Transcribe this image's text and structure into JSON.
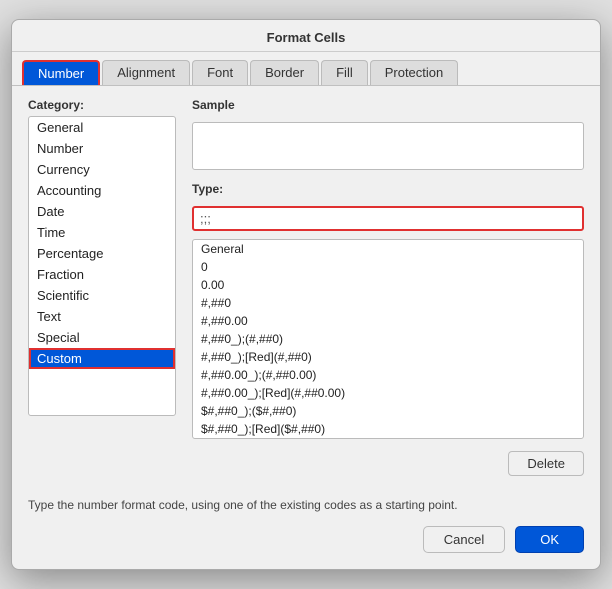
{
  "dialog": {
    "title": "Format Cells"
  },
  "tabs": [
    {
      "id": "number",
      "label": "Number",
      "active": true
    },
    {
      "id": "alignment",
      "label": "Alignment",
      "active": false
    },
    {
      "id": "font",
      "label": "Font",
      "active": false
    },
    {
      "id": "border",
      "label": "Border",
      "active": false
    },
    {
      "id": "fill",
      "label": "Fill",
      "active": false
    },
    {
      "id": "protection",
      "label": "Protection",
      "active": false
    }
  ],
  "left": {
    "category_label": "Category:",
    "categories": [
      {
        "id": "general",
        "label": "General",
        "selected": false
      },
      {
        "id": "number",
        "label": "Number",
        "selected": false
      },
      {
        "id": "currency",
        "label": "Currency",
        "selected": false
      },
      {
        "id": "accounting",
        "label": "Accounting",
        "selected": false
      },
      {
        "id": "date",
        "label": "Date",
        "selected": false
      },
      {
        "id": "time",
        "label": "Time",
        "selected": false
      },
      {
        "id": "percentage",
        "label": "Percentage",
        "selected": false
      },
      {
        "id": "fraction",
        "label": "Fraction",
        "selected": false
      },
      {
        "id": "scientific",
        "label": "Scientific",
        "selected": false
      },
      {
        "id": "text",
        "label": "Text",
        "selected": false
      },
      {
        "id": "special",
        "label": "Special",
        "selected": false
      },
      {
        "id": "custom",
        "label": "Custom",
        "selected": true
      }
    ]
  },
  "right": {
    "sample_label": "Sample",
    "type_label": "Type:",
    "type_value": ";;;",
    "formats": [
      "General",
      "0",
      "0.00",
      "#,##0",
      "#,##0.00",
      "#,##0_);(#,##0)",
      "#,##0_);[Red](#,##0)",
      "#,##0.00_);(#,##0.00)",
      "#,##0.00_);[Red](#,##0.00)",
      "$#,##0_);($#,##0)",
      "$#,##0_);[Red]($#,##0)"
    ],
    "delete_label": "Delete"
  },
  "hint": {
    "text": "Type the number format code, using one of the existing codes as a starting point."
  },
  "footer": {
    "cancel_label": "Cancel",
    "ok_label": "OK"
  }
}
